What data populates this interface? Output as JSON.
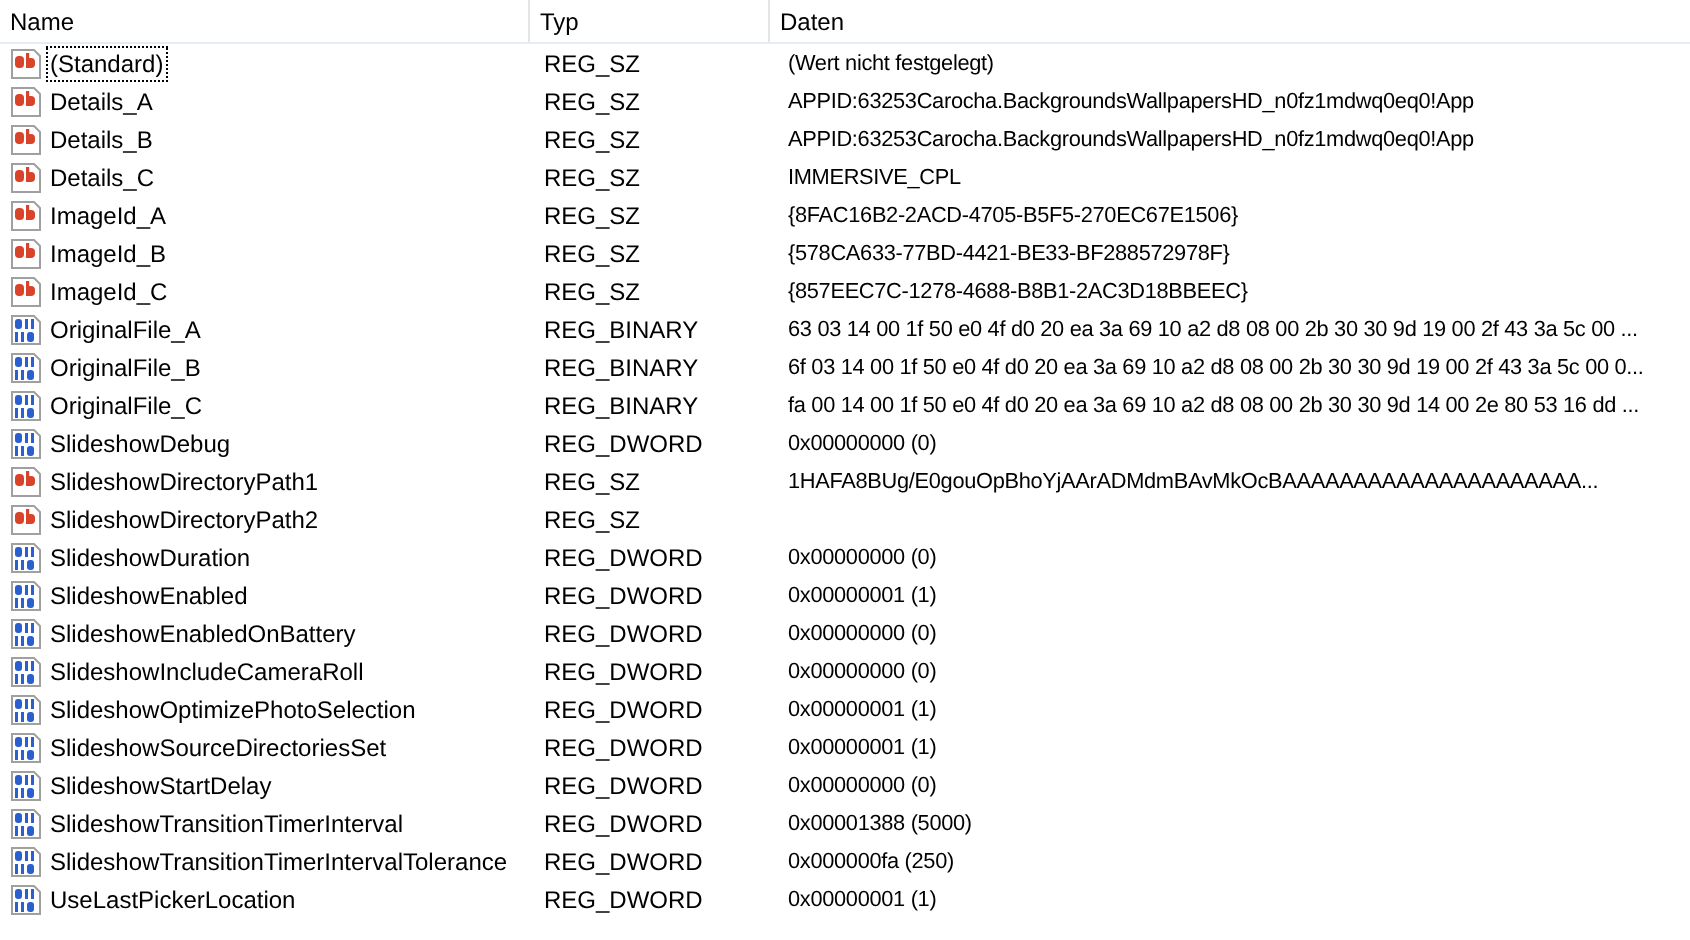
{
  "table": {
    "columns": [
      "Name",
      "Typ",
      "Daten"
    ],
    "rows": [
      {
        "kind": "string",
        "focused": true,
        "name": "(Standard)",
        "type": "REG_SZ",
        "data": "(Wert nicht festgelegt)"
      },
      {
        "kind": "string",
        "focused": false,
        "name": "Details_A",
        "type": "REG_SZ",
        "data": "APPID:63253Carocha.BackgroundsWallpapersHD_n0fz1mdwq0eq0!App"
      },
      {
        "kind": "string",
        "focused": false,
        "name": "Details_B",
        "type": "REG_SZ",
        "data": "APPID:63253Carocha.BackgroundsWallpapersHD_n0fz1mdwq0eq0!App"
      },
      {
        "kind": "string",
        "focused": false,
        "name": "Details_C",
        "type": "REG_SZ",
        "data": "IMMERSIVE_CPL"
      },
      {
        "kind": "string",
        "focused": false,
        "name": "ImageId_A",
        "type": "REG_SZ",
        "data": "{8FAC16B2-2ACD-4705-B5F5-270EC67E1506}"
      },
      {
        "kind": "string",
        "focused": false,
        "name": "ImageId_B",
        "type": "REG_SZ",
        "data": "{578CA633-77BD-4421-BE33-BF288572978F}"
      },
      {
        "kind": "string",
        "focused": false,
        "name": "ImageId_C",
        "type": "REG_SZ",
        "data": "{857EEC7C-1278-4688-B8B1-2AC3D18BBEEC}"
      },
      {
        "kind": "binary",
        "focused": false,
        "name": "OriginalFile_A",
        "type": "REG_BINARY",
        "data": "63 03 14 00 1f 50 e0 4f d0 20 ea 3a 69 10 a2 d8 08 00 2b 30 30 9d 19 00 2f 43 3a 5c 00 ..."
      },
      {
        "kind": "binary",
        "focused": false,
        "name": "OriginalFile_B",
        "type": "REG_BINARY",
        "data": "6f 03 14 00 1f 50 e0 4f d0 20 ea 3a 69 10 a2 d8 08 00 2b 30 30 9d 19 00 2f 43 3a 5c 00 0..."
      },
      {
        "kind": "binary",
        "focused": false,
        "name": "OriginalFile_C",
        "type": "REG_BINARY",
        "data": "fa 00 14 00 1f 50 e0 4f d0 20 ea 3a 69 10 a2 d8 08 00 2b 30 30 9d 14 00 2e 80 53 16 dd ..."
      },
      {
        "kind": "binary",
        "focused": false,
        "name": "SlideshowDebug",
        "type": "REG_DWORD",
        "data": "0x00000000 (0)"
      },
      {
        "kind": "string",
        "focused": false,
        "name": "SlideshowDirectoryPath1",
        "type": "REG_SZ",
        "data": "1HAFA8BUg/E0gouOpBhoYjAArADMdmBAvMkOcBAAAAAAAAAAAAAAAAAAAAA..."
      },
      {
        "kind": "string",
        "focused": false,
        "name": "SlideshowDirectoryPath2",
        "type": "REG_SZ"
      },
      {
        "kind": "binary",
        "focused": false,
        "name": "SlideshowDuration",
        "type": "REG_DWORD",
        "data": "0x00000000 (0)"
      },
      {
        "kind": "binary",
        "focused": false,
        "name": "SlideshowEnabled",
        "type": "REG_DWORD",
        "data": "0x00000001 (1)"
      },
      {
        "kind": "binary",
        "focused": false,
        "name": "SlideshowEnabledOnBattery",
        "type": "REG_DWORD",
        "data": "0x00000000 (0)"
      },
      {
        "kind": "binary",
        "focused": false,
        "name": "SlideshowIncludeCameraRoll",
        "type": "REG_DWORD",
        "data": "0x00000000 (0)"
      },
      {
        "kind": "binary",
        "focused": false,
        "name": "SlideshowOptimizePhotoSelection",
        "type": "REG_DWORD",
        "data": "0x00000001 (1)"
      },
      {
        "kind": "binary",
        "focused": false,
        "name": "SlideshowSourceDirectoriesSet",
        "type": "REG_DWORD",
        "data": "0x00000001 (1)"
      },
      {
        "kind": "binary",
        "focused": false,
        "name": "SlideshowStartDelay",
        "type": "REG_DWORD",
        "data": "0x00000000 (0)"
      },
      {
        "kind": "binary",
        "focused": false,
        "name": "SlideshowTransitionTimerInterval",
        "type": "REG_DWORD",
        "data": "0x00001388 (5000)"
      },
      {
        "kind": "binary",
        "focused": false,
        "name": "SlideshowTransitionTimerIntervalTolerance",
        "type": "REG_DWORD",
        "data": "0x000000fa (250)"
      },
      {
        "kind": "binary",
        "focused": false,
        "name": "UseLastPickerLocation",
        "type": "REG_DWORD",
        "data": "0x00000001 (1)"
      }
    ]
  }
}
